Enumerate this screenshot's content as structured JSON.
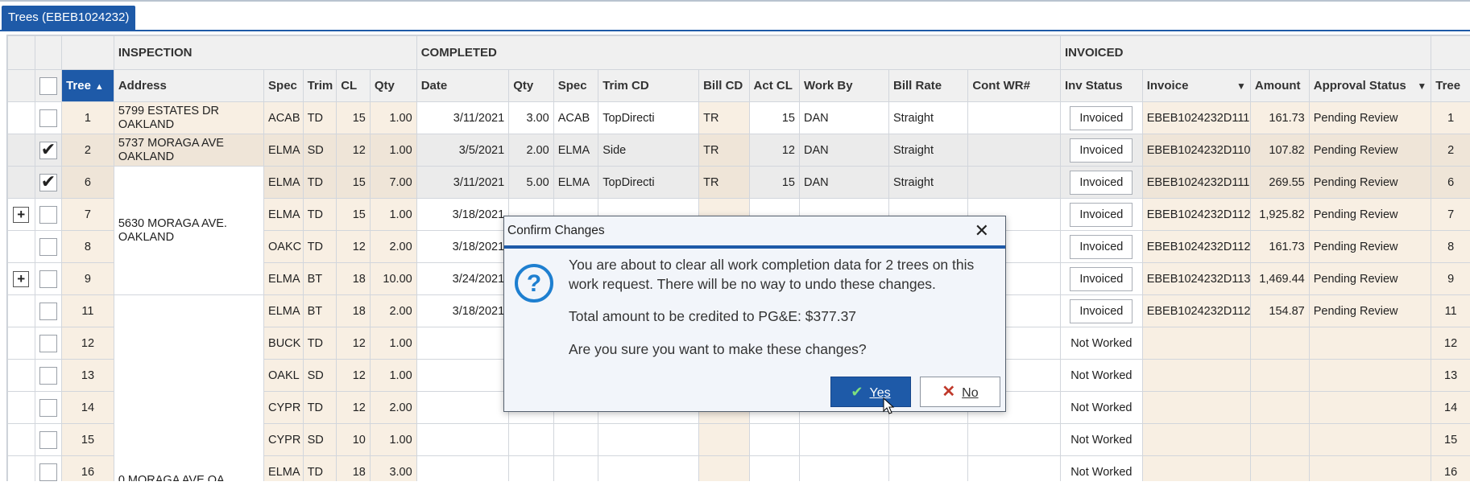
{
  "tab": {
    "label": "Trees (EBEB1024232)"
  },
  "groups": {
    "inspection": "INSPECTION",
    "completed": "COMPLETED",
    "invoiced": "INVOICED"
  },
  "columns": {
    "tree": "Tree",
    "address": "Address",
    "spec": "Spec",
    "trim": "Trim",
    "cl": "CL",
    "qty": "Qty",
    "date": "Date",
    "c_qty": "Qty",
    "c_spec": "Spec",
    "trim_cd": "Trim CD",
    "bill_cd": "Bill CD",
    "act_cl": "Act CL",
    "work_by": "Work By",
    "bill_rate": "Bill Rate",
    "cont_wr": "Cont WR#",
    "inv_status": "Inv Status",
    "invoice": "Invoice",
    "amount": "Amount",
    "approval": "Approval Status",
    "tree2": "Tree"
  },
  "addresses": {
    "a1": "5799 ESTATES DR OAKLAND",
    "a2": "5737 MORAGA AVE OAKLAND",
    "a3": "5630 MORAGA AVE. OAKLAND",
    "a4": "0 MORAGA AVE OA..."
  },
  "rows": [
    {
      "tree": "1",
      "spec": "ACAB",
      "trim": "TD",
      "cl": "15",
      "qty": "1.00",
      "date": "3/11/2021",
      "c_qty": "3.00",
      "c_spec": "ACAB",
      "trim_cd": "TopDirecti",
      "bill_cd": "TR",
      "act_cl": "15",
      "work_by": "DAN",
      "bill_rate": "Straight",
      "inv_status": "Invoiced",
      "invoice": "EBEB1024232D111",
      "amount": "161.73",
      "approval": "Pending Review",
      "tree2": "1"
    },
    {
      "tree": "2",
      "spec": "ELMA",
      "trim": "SD",
      "cl": "12",
      "qty": "1.00",
      "date": "3/5/2021",
      "c_qty": "2.00",
      "c_spec": "ELMA",
      "trim_cd": "Side",
      "bill_cd": "TR",
      "act_cl": "12",
      "work_by": "DAN",
      "bill_rate": "Straight",
      "inv_status": "Invoiced",
      "invoice": "EBEB1024232D110",
      "amount": "107.82",
      "approval": "Pending Review",
      "tree2": "2"
    },
    {
      "tree": "6",
      "spec": "ELMA",
      "trim": "TD",
      "cl": "15",
      "qty": "7.00",
      "date": "3/11/2021",
      "c_qty": "5.00",
      "c_spec": "ELMA",
      "trim_cd": "TopDirecti",
      "bill_cd": "TR",
      "act_cl": "15",
      "work_by": "DAN",
      "bill_rate": "Straight",
      "inv_status": "Invoiced",
      "invoice": "EBEB1024232D111",
      "amount": "269.55",
      "approval": "Pending Review",
      "tree2": "6"
    },
    {
      "tree": "7",
      "spec": "ELMA",
      "trim": "TD",
      "cl": "15",
      "qty": "1.00",
      "date": "3/18/2021",
      "inv_status": "Invoiced",
      "invoice": "EBEB1024232D112",
      "amount": "1,925.82",
      "approval": "Pending Review",
      "tree2": "7"
    },
    {
      "tree": "8",
      "spec": "OAKC",
      "trim": "TD",
      "cl": "12",
      "qty": "2.00",
      "date": "3/18/2021",
      "inv_status": "Invoiced",
      "invoice": "EBEB1024232D112",
      "amount": "161.73",
      "approval": "Pending Review",
      "tree2": "8"
    },
    {
      "tree": "9",
      "spec": "ELMA",
      "trim": "BT",
      "cl": "18",
      "qty": "10.00",
      "date": "3/24/2021",
      "inv_status": "Invoiced",
      "invoice": "EBEB1024232D113",
      "amount": "1,469.44",
      "approval": "Pending Review",
      "tree2": "9"
    },
    {
      "tree": "11",
      "spec": "ELMA",
      "trim": "BT",
      "cl": "18",
      "qty": "2.00",
      "date": "3/18/2021",
      "inv_status": "Invoiced",
      "invoice": "EBEB1024232D112",
      "amount": "154.87",
      "approval": "Pending Review",
      "tree2": "11"
    },
    {
      "tree": "12",
      "spec": "BUCK",
      "trim": "TD",
      "cl": "12",
      "qty": "1.00",
      "inv_status": "Not Worked",
      "tree2": "12"
    },
    {
      "tree": "13",
      "spec": "OAKL",
      "trim": "SD",
      "cl": "12",
      "qty": "1.00",
      "inv_status": "Not Worked",
      "tree2": "13"
    },
    {
      "tree": "14",
      "spec": "CYPR",
      "trim": "TD",
      "cl": "12",
      "qty": "2.00",
      "inv_status": "Not Worked",
      "tree2": "14"
    },
    {
      "tree": "15",
      "spec": "CYPR",
      "trim": "SD",
      "cl": "10",
      "qty": "1.00",
      "inv_status": "Not Worked",
      "tree2": "15"
    },
    {
      "tree": "16",
      "spec": "ELMA",
      "trim": "TD",
      "cl": "18",
      "qty": "3.00",
      "inv_status": "Not Worked",
      "tree2": "16"
    }
  ],
  "dialog": {
    "title": "Confirm Changes",
    "message": "You are about to clear all work completion data for 2 trees on this work request.  There will be no way to undo these changes.",
    "credit": "Total amount to be credited to PG&E: $377.37",
    "question": "Are you sure you want to make these changes?",
    "yes_label": "Yes",
    "no_label": "No"
  },
  "colors": {
    "accent": "#1e5aa8",
    "tan": "#f8efe3",
    "no_icon": "#c0392b",
    "yes_icon": "#5cb85c"
  }
}
